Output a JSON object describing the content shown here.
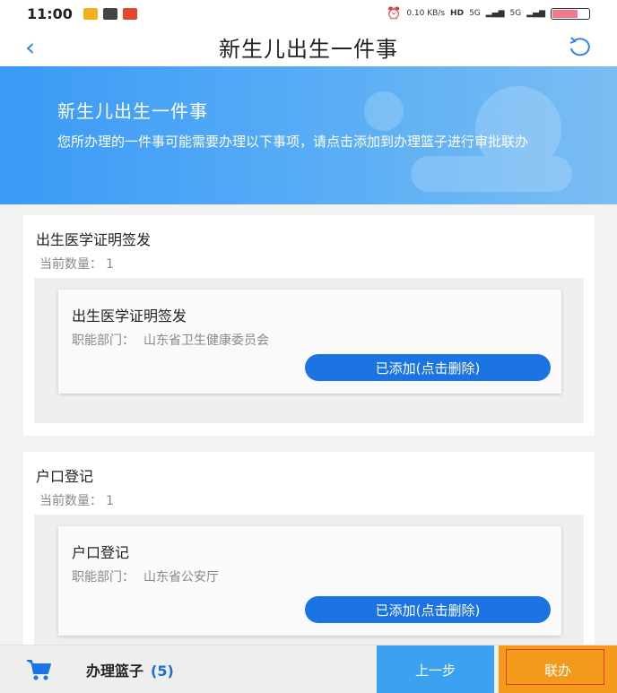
{
  "status_bar": {
    "time": "11:00",
    "net_speed": "0.10 KB/s",
    "signal_1": "5G",
    "signal_2": "5G",
    "battery_level": 0.7
  },
  "header": {
    "title": "新生儿出生一件事",
    "back_icon": "chevron-left-icon",
    "refresh_icon": "refresh-icon"
  },
  "banner": {
    "title": "新生儿出生一件事",
    "description": "您所办理的一件事可能需要办理以下事项，请点击添加到办理篮子进行审批联办"
  },
  "sections": [
    {
      "title": "出生医学证明签发",
      "count_label": "当前数量：",
      "count_value": "1",
      "item": {
        "name": "出生医学证明签发",
        "dept_label": "职能部门：",
        "dept_value": "山东省卫生健康委员会",
        "button_label": "已添加(点击删除)"
      }
    },
    {
      "title": "户口登记",
      "count_label": "当前数量：",
      "count_value": "1",
      "item": {
        "name": "户口登记",
        "dept_label": "职能部门：",
        "dept_value": "山东省公安厅",
        "button_label": "已添加(点击删除)"
      }
    }
  ],
  "bottom_bar": {
    "basket_label": "办理篮子",
    "basket_count": "(5)",
    "prev_label": "上一步",
    "joint_label": "联办",
    "cart_icon": "cart-icon"
  },
  "colors": {
    "primary": "#1b73e4",
    "prev_button": "#3aa2f0",
    "joint_button": "#f39a1b",
    "banner": "#3b9af6"
  }
}
